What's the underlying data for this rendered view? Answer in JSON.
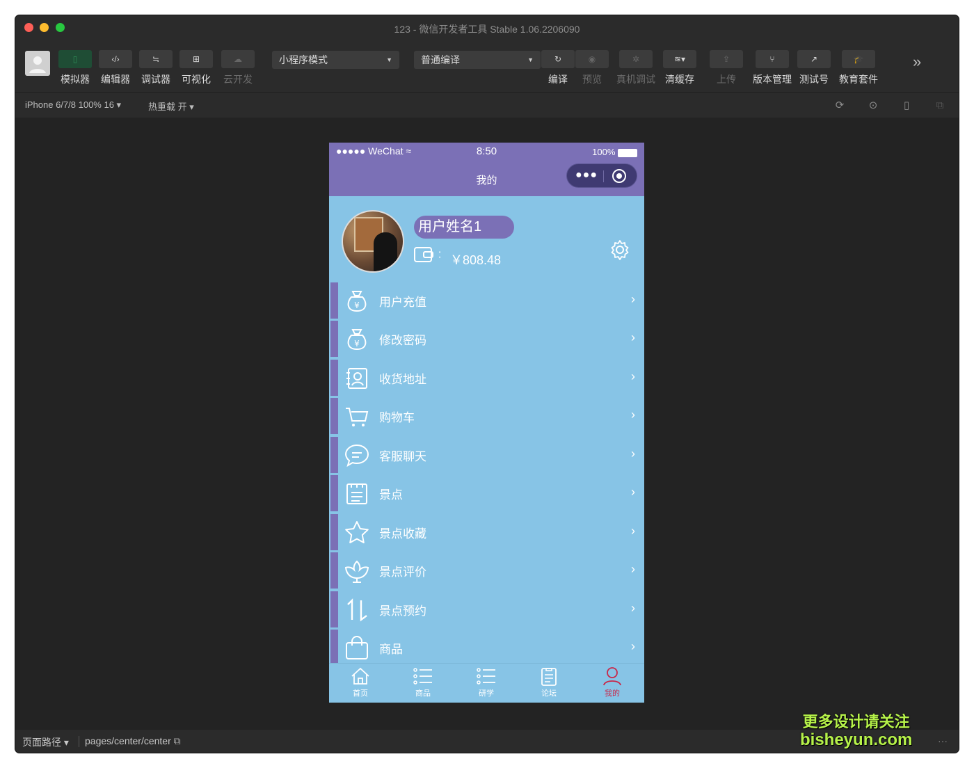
{
  "window": {
    "title": "123 - 微信开发者工具 Stable 1.06.2206090"
  },
  "toolbar": {
    "simulator": "模拟器",
    "editor": "编辑器",
    "debugger": "调试器",
    "visual": "可视化",
    "cloud": "云开发",
    "mode_select": "小程序模式",
    "compile_select": "普通编译",
    "compile": "编译",
    "preview": "预览",
    "real_debug": "真机调试",
    "clear_cache": "清缓存",
    "upload": "上传",
    "version": "版本管理",
    "test_account": "测试号",
    "edu": "教育套件"
  },
  "subbar": {
    "device": "iPhone 6/7/8 100% 16",
    "hot_reload": "热重载 开"
  },
  "phone": {
    "status": {
      "signal": "●●●●● WeChat",
      "time": "8:50",
      "battery": "100%"
    },
    "nav_title": "我的",
    "user": {
      "name": "用户姓名1",
      "colon": ":",
      "balance": "￥808.48"
    },
    "menu": [
      {
        "label": "用户充值",
        "icon": "money-bag-icon"
      },
      {
        "label": "修改密码",
        "icon": "money-bag-icon"
      },
      {
        "label": "收货地址",
        "icon": "address-card-icon"
      },
      {
        "label": "购物车",
        "icon": "cart-icon"
      },
      {
        "label": "客服聊天",
        "icon": "chat-bubble-icon"
      },
      {
        "label": "景点",
        "icon": "list-board-icon"
      },
      {
        "label": "景点收藏",
        "icon": "star-icon"
      },
      {
        "label": "景点评价",
        "icon": "flower-icon"
      },
      {
        "label": "景点预约",
        "icon": "sort-arrows-icon"
      },
      {
        "label": "商品",
        "icon": "shopping-bag-icon"
      }
    ],
    "tabs": [
      {
        "label": "首页",
        "icon": "home-icon"
      },
      {
        "label": "商品",
        "icon": "list-icon"
      },
      {
        "label": "研学",
        "icon": "list-icon"
      },
      {
        "label": "论坛",
        "icon": "clipboard-icon"
      },
      {
        "label": "我的",
        "icon": "user-icon"
      }
    ],
    "colors": {
      "primary": "#7b70b6",
      "background": "#87c4e6",
      "active_tab": "#c8284a"
    }
  },
  "bottombar": {
    "path_label": "页面路径",
    "path": "pages/center/center",
    "more": "···"
  },
  "watermark": {
    "line1": "更多设计请关注",
    "line2": "bisheyun.com"
  }
}
